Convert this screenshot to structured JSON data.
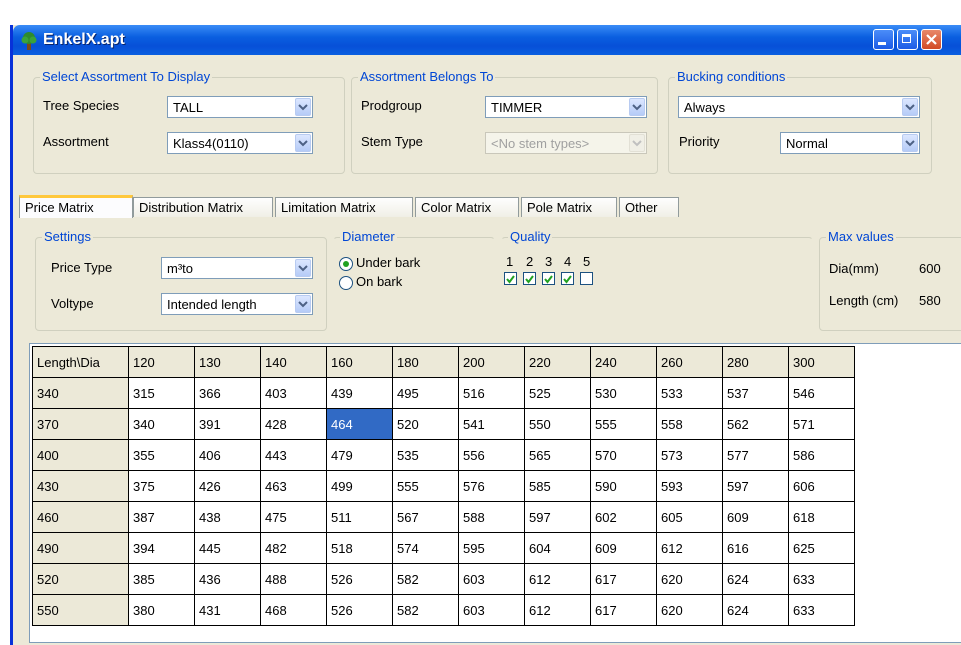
{
  "window": {
    "title": "EnkelX.apt"
  },
  "select_group": {
    "title": "Select Assortment To Display",
    "tree_species_label": "Tree Species",
    "tree_species_value": "TALL",
    "assortment_label": "Assortment",
    "assortment_value": "Klass4(0110)"
  },
  "belongs_group": {
    "title": "Assortment Belongs To",
    "prodgroup_label": "Prodgroup",
    "prodgroup_value": "TIMMER",
    "stem_type_label": "Stem Type",
    "stem_type_value": "<No stem types>"
  },
  "bucking_group": {
    "title": "Bucking conditions",
    "condition_value": "Always",
    "priority_label": "Priority",
    "priority_value": "Normal"
  },
  "tabs": [
    {
      "label": "Price Matrix",
      "active": true
    },
    {
      "label": "Distribution Matrix",
      "active": false
    },
    {
      "label": "Limitation Matrix",
      "active": false
    },
    {
      "label": "Color Matrix",
      "active": false
    },
    {
      "label": "Pole Matrix",
      "active": false
    },
    {
      "label": "Other",
      "active": false
    }
  ],
  "settings": {
    "title": "Settings",
    "price_type_label": "Price Type",
    "price_type_value": "m³to",
    "voltype_label": "Voltype",
    "voltype_value": "Intended length"
  },
  "diameter": {
    "title": "Diameter",
    "under_bark": "Under bark",
    "on_bark": "On bark",
    "selected": "Under bark"
  },
  "quality": {
    "title": "Quality",
    "levels": [
      "1",
      "2",
      "3",
      "4",
      "5"
    ],
    "checked": [
      true,
      true,
      true,
      true,
      false
    ]
  },
  "max_values": {
    "title": "Max values",
    "dia_label": "Dia(mm)",
    "dia_value": "600",
    "length_label": "Length (cm)",
    "length_value": "580"
  },
  "price_matrix": {
    "corner": "Length\\Dia",
    "columns": [
      "120",
      "130",
      "140",
      "160",
      "180",
      "200",
      "220",
      "240",
      "260",
      "280",
      "300"
    ],
    "rows": [
      {
        "length": "340",
        "values": [
          "315",
          "366",
          "403",
          "439",
          "495",
          "516",
          "525",
          "530",
          "533",
          "537",
          "546"
        ]
      },
      {
        "length": "370",
        "values": [
          "340",
          "391",
          "428",
          "464",
          "520",
          "541",
          "550",
          "555",
          "558",
          "562",
          "571"
        ]
      },
      {
        "length": "400",
        "values": [
          "355",
          "406",
          "443",
          "479",
          "535",
          "556",
          "565",
          "570",
          "573",
          "577",
          "586"
        ]
      },
      {
        "length": "430",
        "values": [
          "375",
          "426",
          "463",
          "499",
          "555",
          "576",
          "585",
          "590",
          "593",
          "597",
          "606"
        ]
      },
      {
        "length": "460",
        "values": [
          "387",
          "438",
          "475",
          "511",
          "567",
          "588",
          "597",
          "602",
          "605",
          "609",
          "618"
        ]
      },
      {
        "length": "490",
        "values": [
          "394",
          "445",
          "482",
          "518",
          "574",
          "595",
          "604",
          "609",
          "612",
          "616",
          "625"
        ]
      },
      {
        "length": "520",
        "values": [
          "385",
          "436",
          "488",
          "526",
          "582",
          "603",
          "612",
          "617",
          "620",
          "624",
          "633"
        ]
      },
      {
        "length": "550",
        "values": [
          "380",
          "431",
          "468",
          "526",
          "582",
          "603",
          "612",
          "617",
          "620",
          "624",
          "633"
        ]
      }
    ],
    "selected_row": 1,
    "selected_col": 3
  }
}
